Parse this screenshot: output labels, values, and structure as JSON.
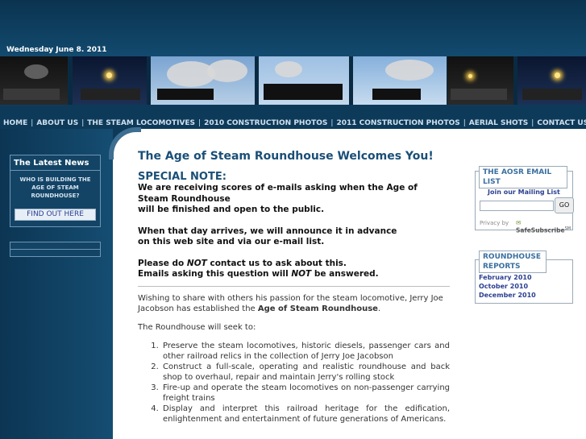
{
  "header": {
    "date": "Wednesday June 8. 2011"
  },
  "nav": {
    "items": [
      "HOME",
      "ABOUT US",
      "THE STEAM LOCOMOTIVES",
      "2010 CONSTRUCTION PHOTOS",
      "2011 CONSTRUCTION PHOTOS",
      "AERIAL SHOTS",
      "CONTACT US"
    ],
    "separator": "|"
  },
  "sidebar": {
    "latest_title": "The Latest News",
    "latest_text": "WHO IS BUILDING THE AGE OF STEAM ROUNDHOUSE?",
    "find_button": "FIND OUT HERE"
  },
  "main": {
    "title": "The Age of Steam Roundhouse Welcomes You!",
    "special_note": "SPECIAL NOTE:",
    "note1_a": "We are receiving scores of e-mails asking when the Age of Steam Roundhouse",
    "note1_b": "will be finished and open to the public.",
    "note2_a": "When that day arrives, we will announce it in advance",
    "note2_b": "on this web site and via our e-mail list.",
    "note3_a1": "Please do ",
    "note3_a2": "NOT",
    "note3_a3": " contact us to ask about this.",
    "note3_b1": "Emails asking this question will ",
    "note3_b2": "NOT",
    "note3_b3": " be answered.",
    "intro_a": "Wishing to share with others his passion for the steam locomotive, Jerry Joe Jacobson has established the ",
    "intro_b": "Age of Steam Roundhouse",
    "intro_c": ".",
    "seek": "The Roundhouse will seek to:",
    "goals": [
      "Preserve the steam locomotives, historic diesels, passenger cars and other railroad relics in the collection of Jerry Joe Jacobson",
      "Construct a full-scale, operating and realistic roundhouse and back shop to overhaul, repair and maintain Jerry's rolling stock",
      "Fire-up and operate the steam locomotives on non-passenger carrying freight trains",
      "Display and interpret this railroad heritage for the edification, enlightenment and entertainment of future generations of Americans."
    ]
  },
  "mailing": {
    "title": "THE AOSR EMAIL LIST",
    "join": "Join our Mailing List",
    "input_value": "",
    "go_button": "GO",
    "privacy": "Privacy by",
    "safesubscribe": "SafeSubscribe",
    "sm": "SM"
  },
  "reports": {
    "title": "ROUNDHOUSE REPORTS",
    "items": [
      "February 2010",
      "October 2010",
      "December 2010"
    ]
  }
}
